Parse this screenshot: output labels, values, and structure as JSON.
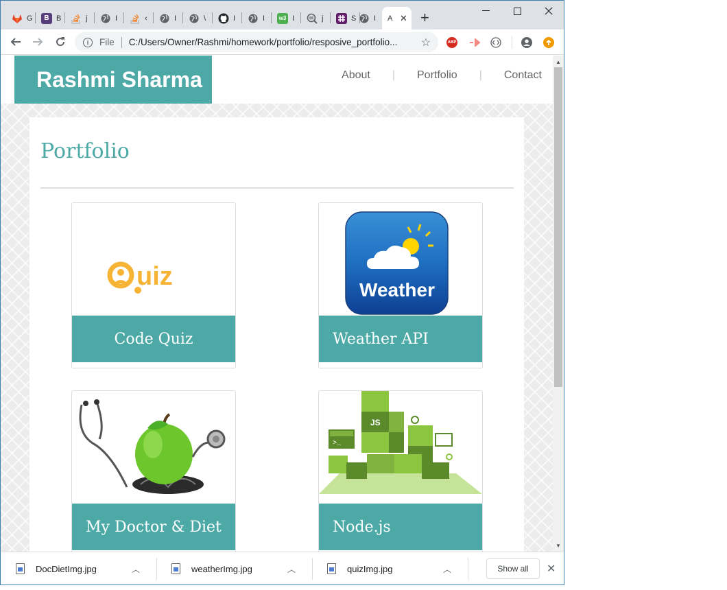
{
  "browser": {
    "tabs": [
      {
        "title": "G",
        "icon": "gitlab-icon",
        "color": "#e24329"
      },
      {
        "title": "B",
        "icon": "bootstrap-icon",
        "color": "#563d7c"
      },
      {
        "title": "j",
        "icon": "stackoverflow-icon",
        "color": "#f48024"
      },
      {
        "title": "I",
        "icon": "globe-icon",
        "color": "#5f6368"
      },
      {
        "title": "‹",
        "icon": "stackoverflow-icon",
        "color": "#f48024"
      },
      {
        "title": "I",
        "icon": "globe-icon",
        "color": "#5f6368"
      },
      {
        "title": "\\",
        "icon": "globe-icon",
        "color": "#5f6368"
      },
      {
        "title": "I",
        "icon": "github-icon",
        "color": "#24292e"
      },
      {
        "title": "I",
        "icon": "globe-icon",
        "color": "#5f6368"
      },
      {
        "title": "I",
        "icon": "w3schools-icon",
        "color": "#4caf50"
      },
      {
        "title": "j",
        "icon": "search-globe-icon",
        "color": "#5f6368"
      },
      {
        "title": "S",
        "icon": "slack-icon",
        "color": "#611f69"
      },
      {
        "title": "I",
        "icon": "globe-icon",
        "color": "#5f6368"
      },
      {
        "title": "A",
        "icon": "page-icon",
        "color": "#5f6368",
        "active": true
      }
    ],
    "new_tab": "+",
    "window_controls": {
      "minimize": "—",
      "maximize": "☐",
      "close": "✕"
    },
    "address": {
      "scheme": "File",
      "url": "C:/Users/Owner/Rashmi/homework/portfolio/resposive_portfolio..."
    },
    "extensions": [
      {
        "name": "adblock-plus-icon",
        "label": "ABP",
        "color": "#d52b1e"
      },
      {
        "name": "cast-extension-icon",
        "label": "▷",
        "color": "#f28b82"
      },
      {
        "name": "code-extension-icon",
        "label": "‹›",
        "color": "#5f6368"
      }
    ]
  },
  "site": {
    "brand": "Rashmi Sharma",
    "nav": [
      "About",
      "Portfolio",
      "Contact"
    ],
    "section_title": "Portfolio",
    "cards": [
      {
        "title": "Code Quiz",
        "image": "quiz-logo-image"
      },
      {
        "title": "Weather API",
        "image": "weather-app-image"
      },
      {
        "title": "My Doctor & Diet",
        "image": "doctor-apple-image"
      },
      {
        "title": "Node.js",
        "image": "nodejs-cubes-image"
      }
    ],
    "weather_label": "Weather",
    "quiz_label": "uiz"
  },
  "downloads": {
    "files": [
      {
        "name": "DocDietImg.jpg"
      },
      {
        "name": "weatherImg.jpg"
      },
      {
        "name": "quizImg.jpg"
      }
    ],
    "show_all": "Show all",
    "close": "✕"
  },
  "colors": {
    "accent": "#4ca9a6",
    "tabstrip": "#dee1e6"
  }
}
